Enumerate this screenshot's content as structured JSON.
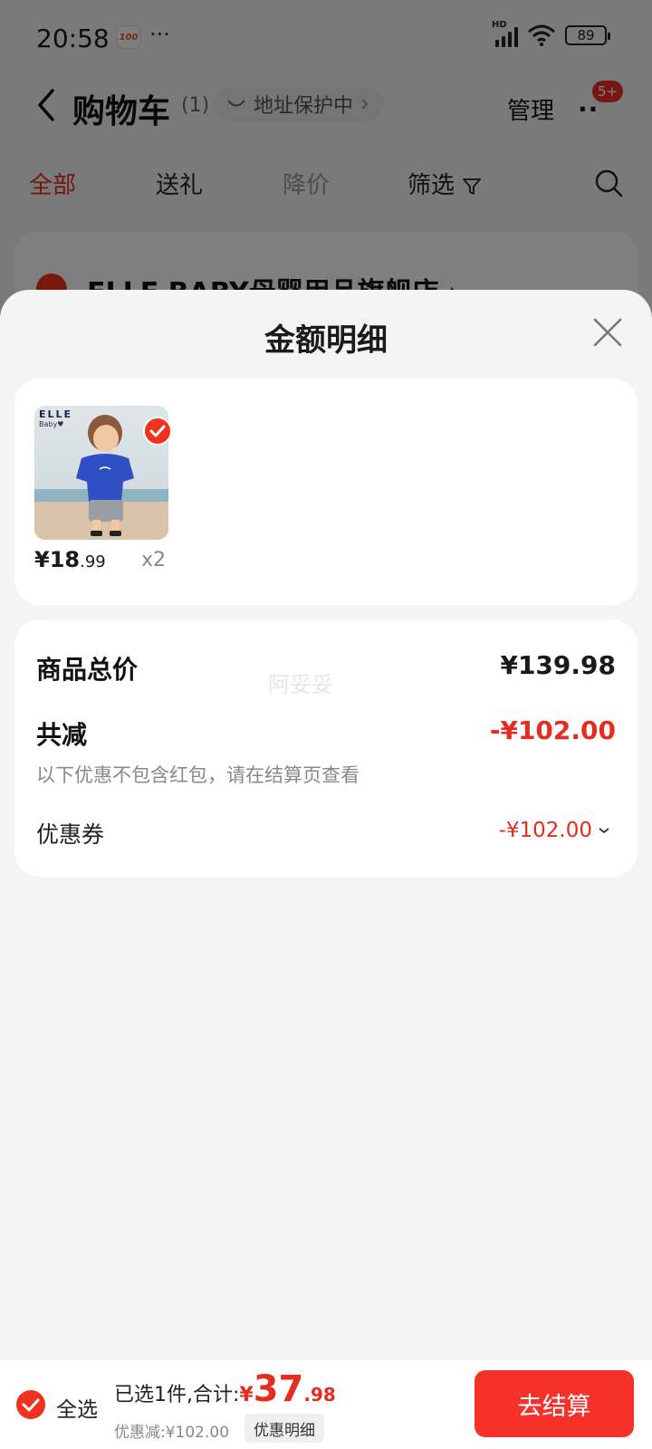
{
  "status_bar": {
    "time": "20:58",
    "app_icon_text": "100",
    "dots": "···",
    "network_label": "HD",
    "battery": "89"
  },
  "nav": {
    "title": "购物车",
    "count": "(1)",
    "address_protect": "地址保护中",
    "manage": "管理",
    "more": "··",
    "badge": "5+"
  },
  "filter_tabs": {
    "all": "全部",
    "gift": "送礼",
    "price_drop": "降价",
    "filter": "筛选"
  },
  "store": {
    "name": "ELLE BABY母婴用品旗舰店 ›"
  },
  "sheet": {
    "title": "金额明细",
    "item": {
      "brand": "ELLE",
      "brand_sub": "Baby♥",
      "price_main": "¥18",
      "price_cents": ".99",
      "quantity": "x2"
    },
    "total_label": "商品总价",
    "total_value": "¥139.98",
    "watermark": "阿妥妥",
    "reduce_label": "共减",
    "reduce_value": "-¥102.00",
    "reduce_note": "以下优惠不包含红包，请在结算页查看",
    "coupon_label": "优惠券",
    "coupon_value": "-¥102.00"
  },
  "footer": {
    "select_all": "全选",
    "selected_text": "已选1件,合计:",
    "currency": "¥",
    "total_int": "37",
    "total_dec": ".98",
    "discount_text": "优惠减:¥102.00",
    "detail_button": "优惠明细",
    "checkout_button": "去结算"
  },
  "colors": {
    "accent_red": "#e52d1f",
    "button_red": "#f5312a",
    "sheet_bg": "#f4f4f4"
  }
}
